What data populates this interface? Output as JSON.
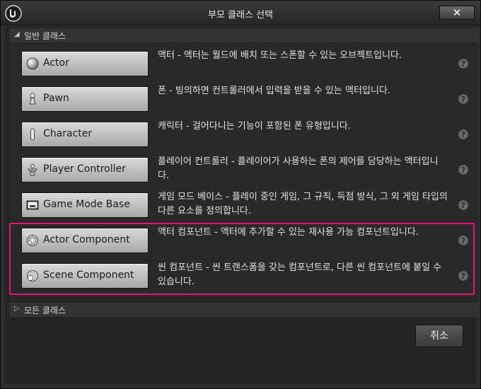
{
  "window": {
    "title": "부모 클래스 선택",
    "close_label": "✕"
  },
  "common_section": {
    "label": "일반 클래스",
    "expanded": true
  },
  "classes": [
    {
      "name": "Actor",
      "icon": "actor-sphere-icon",
      "description": "액터 - 액터는 월드에 배치 또는 스폰할 수 있는 오브젝트입니다."
    },
    {
      "name": "Pawn",
      "icon": "pawn-icon",
      "description": "폰 - 빙의하면 컨트롤러에서 입력을 받을 수 있는 액터입니다."
    },
    {
      "name": "Character",
      "icon": "character-icon",
      "description": "캐릭터 - 걸어다니는 기능이 포함된 폰 유형입니다."
    },
    {
      "name": "Player Controller",
      "icon": "player-controller-icon",
      "description": "플레이어 컨트롤러 - 플레이어가 사용하는 폰의 제어를 담당하는 액터입니다."
    },
    {
      "name": "Game Mode Base",
      "icon": "game-mode-icon",
      "description": "게임 모드 베이스 - 플레이 중인 게임, 그 규칙, 득점 방식, 그 외 게임 타입의 다른 요소를 정의합니다."
    },
    {
      "name": "Actor Component",
      "icon": "actor-component-icon",
      "description": "액터 컴포넌트 - 액터에 추가할 수 있는 재사용 가능 컴포넌트입니다."
    },
    {
      "name": "Scene Component",
      "icon": "scene-component-icon",
      "description": "씬 컴포넌트 - 씬 트랜스폼을 갖는 컴포넌트로, 다른 씬 컴포넌트에 붙일 수 있습니다."
    }
  ],
  "all_section": {
    "label": "모든 클래스",
    "expanded": false
  },
  "footer": {
    "cancel_label": "취소"
  },
  "colors": {
    "highlight": "#e0157a"
  }
}
